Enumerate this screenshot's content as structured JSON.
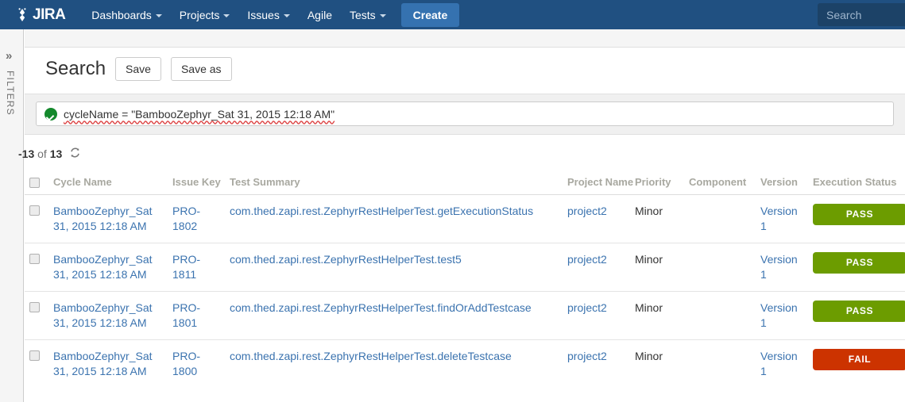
{
  "nav": {
    "logo_text": "JIRA",
    "logo_icon": "jira-logo-icon",
    "items": [
      {
        "label": "Dashboards",
        "has_caret": true
      },
      {
        "label": "Projects",
        "has_caret": true
      },
      {
        "label": "Issues",
        "has_caret": true
      },
      {
        "label": "Agile",
        "has_caret": false
      },
      {
        "label": "Tests",
        "has_caret": true
      }
    ],
    "create_label": "Create",
    "search_placeholder": "Search",
    "search_value": ""
  },
  "rail": {
    "expand_icon": "»",
    "label": "FILTERS"
  },
  "header": {
    "title": "Search",
    "save_label": "Save",
    "save_as_label": "Save as"
  },
  "query": {
    "status_icon": "valid-check-icon",
    "text": "cycleName = \"BambooZephyr_Sat 31, 2015 12:18 AM\""
  },
  "results": {
    "count_prefix": "-13",
    "count_of": " of ",
    "count_total": "13",
    "refresh_icon": "refresh-icon",
    "columns": [
      "Cycle Name",
      "Issue Key",
      "Test Summary",
      "Project Name",
      "Priority",
      "Component",
      "Version",
      "Execution Status"
    ],
    "rows": [
      {
        "cycle_name": "BambooZephyr_Sat 31, 2015 12:18 AM",
        "issue_key": "PRO-1802",
        "test_summary": "com.thed.zapi.rest.ZephyrRestHelperTest.getExecutionStatus",
        "project_name": "project2",
        "priority": "Minor",
        "component": "",
        "version": "Version 1",
        "status": "PASS",
        "status_color": "#6c9c00"
      },
      {
        "cycle_name": "BambooZephyr_Sat 31, 2015 12:18 AM",
        "issue_key": "PRO-1811",
        "test_summary": "com.thed.zapi.rest.ZephyrRestHelperTest.test5",
        "project_name": "project2",
        "priority": "Minor",
        "component": "",
        "version": "Version 1",
        "status": "PASS",
        "status_color": "#6c9c00"
      },
      {
        "cycle_name": "BambooZephyr_Sat 31, 2015 12:18 AM",
        "issue_key": "PRO-1801",
        "test_summary": "com.thed.zapi.rest.ZephyrRestHelperTest.findOrAddTestcase",
        "project_name": "project2",
        "priority": "Minor",
        "component": "",
        "version": "Version 1",
        "status": "PASS",
        "status_color": "#6c9c00"
      },
      {
        "cycle_name": "BambooZephyr_Sat 31, 2015 12:18 AM",
        "issue_key": "PRO-1800",
        "test_summary": "com.thed.zapi.rest.ZephyrRestHelperTest.deleteTestcase",
        "project_name": "project2",
        "priority": "Minor",
        "component": "",
        "version": "Version 1",
        "status": "FAIL",
        "status_color": "#cc3300"
      }
    ]
  },
  "colors": {
    "nav_bg": "#205081",
    "create_btn": "#3572b0",
    "link": "#3b73af",
    "pass": "#6c9c00",
    "fail": "#cc3300",
    "valid": "#14892c"
  }
}
